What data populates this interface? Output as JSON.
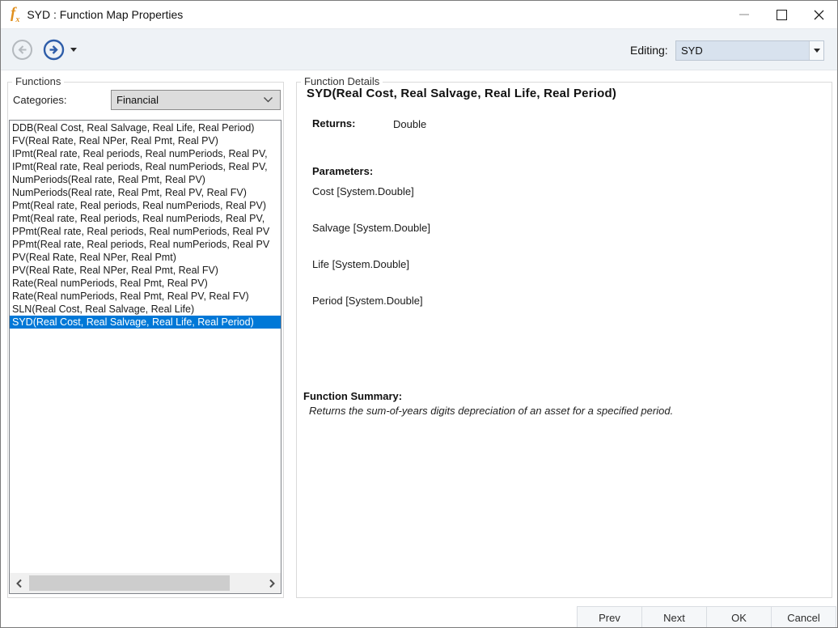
{
  "window": {
    "title": "SYD : Function Map Properties"
  },
  "toolbar": {
    "editing_label": "Editing:",
    "editing_value": "SYD"
  },
  "functions_panel": {
    "group_label": "Functions",
    "categories_label": "Categories:",
    "categories_value": "Financial",
    "selected_index": 15,
    "items": [
      "DDB(Real Cost, Real Salvage, Real Life, Real Period)",
      "FV(Real Rate, Real NPer, Real Pmt, Real PV)",
      "IPmt(Real rate, Real periods, Real numPeriods, Real PV,",
      "IPmt(Real rate, Real periods, Real numPeriods, Real PV,",
      "NumPeriods(Real rate, Real Pmt, Real PV)",
      "NumPeriods(Real rate, Real Pmt, Real PV, Real FV)",
      "Pmt(Real rate, Real periods, Real numPeriods, Real PV)",
      "Pmt(Real rate, Real periods, Real numPeriods, Real PV,",
      "PPmt(Real rate, Real periods, Real numPeriods, Real PV",
      "PPmt(Real rate, Real periods, Real numPeriods, Real PV",
      "PV(Real Rate, Real NPer, Real Pmt)",
      "PV(Real Rate, Real NPer, Real Pmt, Real FV)",
      "Rate(Real numPeriods, Real Pmt, Real PV)",
      "Rate(Real numPeriods, Real Pmt, Real PV, Real FV)",
      "SLN(Real Cost, Real Salvage, Real Life)",
      "SYD(Real Cost, Real Salvage, Real Life, Real Period)"
    ]
  },
  "details_panel": {
    "group_label": "Function Details",
    "signature": "SYD(Real Cost, Real Salvage, Real Life, Real Period)",
    "returns_label": "Returns:",
    "returns_value": "Double",
    "parameters_label": "Parameters:",
    "parameters": [
      "Cost [System.Double]",
      "Salvage [System.Double]",
      "Life [System.Double]",
      "Period [System.Double]"
    ],
    "summary_label": "Function Summary:",
    "summary_text": "Returns the sum-of-years digits depreciation of an asset for a specified period."
  },
  "footer": {
    "buttons": [
      "Prev",
      "Next",
      "OK",
      "Cancel"
    ]
  },
  "colors": {
    "selection_blue": "#0078d7",
    "forward_arrow_blue": "#2e5da9",
    "back_arrow_gray": "#b4b9be",
    "fx_icon_orange": "#e08f1d",
    "toolbar_bg": "#eef2f6",
    "editing_combo_bg": "#d8e2ee"
  }
}
